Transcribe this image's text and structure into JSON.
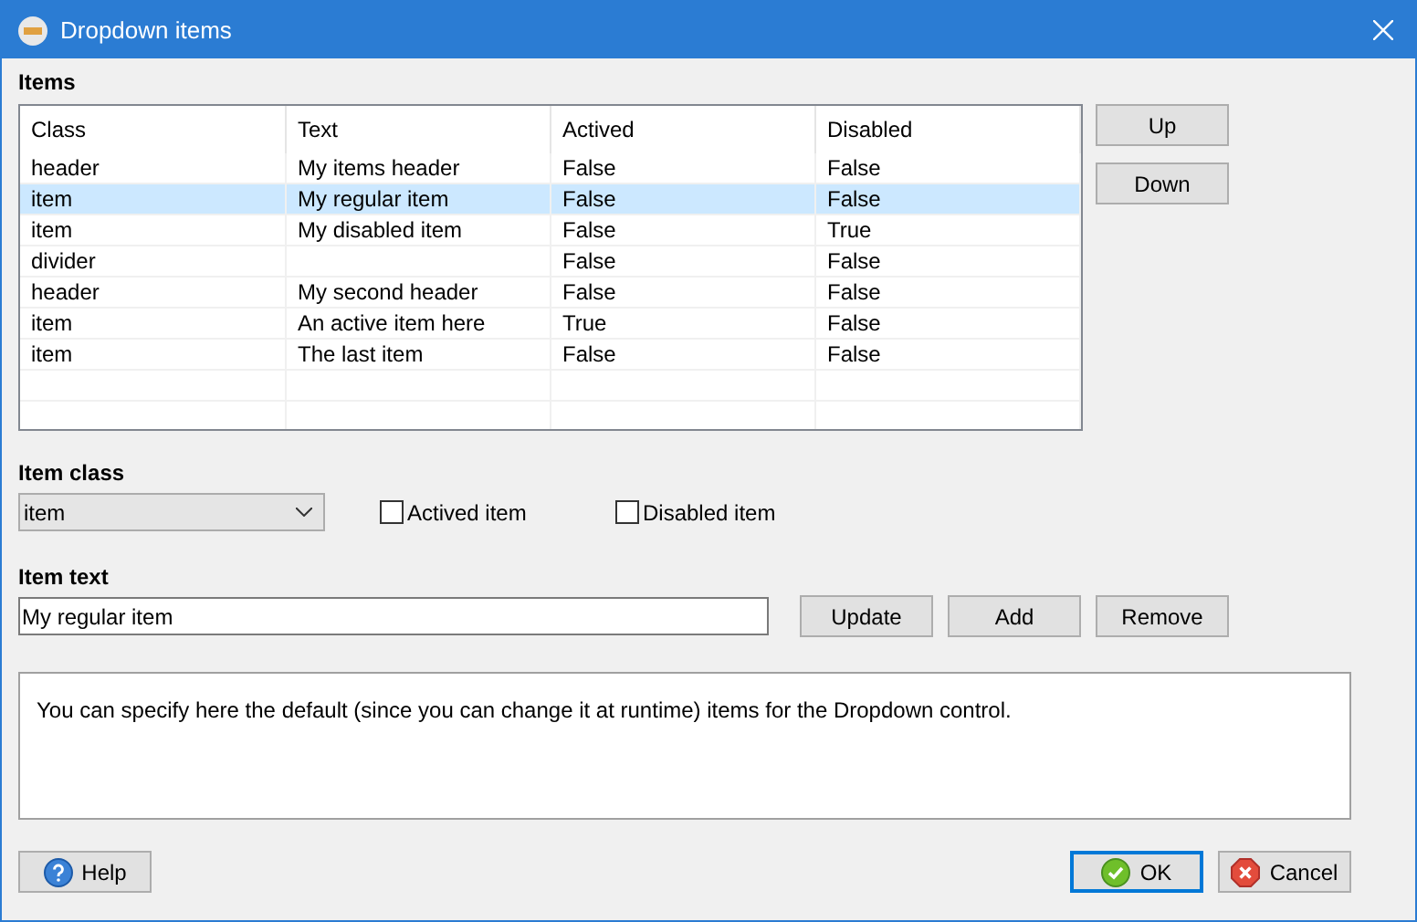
{
  "window": {
    "title": "Dropdown items"
  },
  "items_label": "Items",
  "table": {
    "columns": [
      "Class",
      "Text",
      "Actived",
      "Disabled"
    ],
    "rows": [
      {
        "cells": [
          "header",
          "My items header",
          "False",
          "False"
        ],
        "selected": false
      },
      {
        "cells": [
          "item",
          "My regular item",
          "False",
          "False"
        ],
        "selected": true
      },
      {
        "cells": [
          "item",
          "My disabled item",
          "False",
          "True"
        ],
        "selected": false
      },
      {
        "cells": [
          "divider",
          "",
          "False",
          "False"
        ],
        "selected": false
      },
      {
        "cells": [
          "header",
          "My second header",
          "False",
          "False"
        ],
        "selected": false
      },
      {
        "cells": [
          "item",
          "An active item here",
          "True",
          "False"
        ],
        "selected": false
      },
      {
        "cells": [
          "item",
          "The last item",
          "False",
          "False"
        ],
        "selected": false
      }
    ]
  },
  "side_buttons": [
    "Up",
    "Down"
  ],
  "item_class": {
    "label": "Item class",
    "value": "item"
  },
  "checkboxes": [
    {
      "label": "Actived item",
      "checked": false
    },
    {
      "label": "Disabled item",
      "checked": false
    }
  ],
  "item_text": {
    "label": "Item text",
    "value": "My regular item"
  },
  "edit_buttons": [
    "Update",
    "Add",
    "Remove"
  ],
  "description": "You can specify here the default (since you can change it at runtime) items for the Dropdown control.",
  "footer_buttons": [
    {
      "kind": "help",
      "label": "Help",
      "focused": false
    },
    {
      "kind": "ok",
      "label": "OK",
      "focused": true
    },
    {
      "kind": "cancel",
      "label": "Cancel",
      "focused": false
    }
  ]
}
